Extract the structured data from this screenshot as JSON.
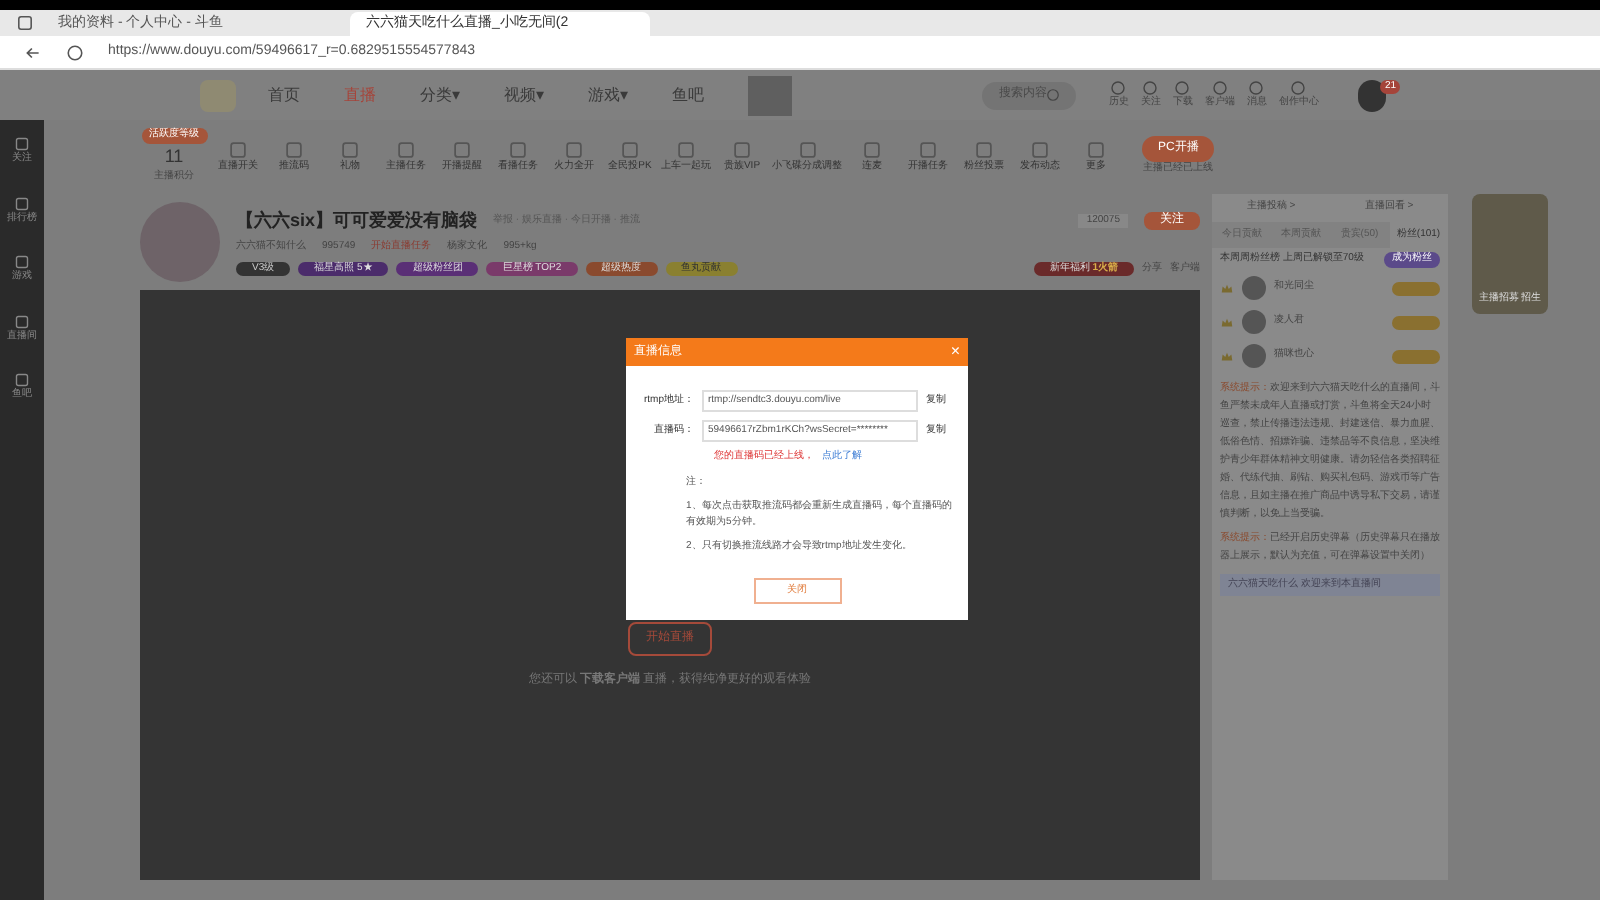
{
  "browser": {
    "tabs": [
      {
        "title": "我的资料 - 个人中心 - 斗鱼",
        "selected": false
      },
      {
        "title": "六六猫天吃什么直播_小吃无间(2",
        "selected": true
      }
    ],
    "url": "https://www.douyu.com/59496617_r=0.6829515554577843"
  },
  "nav": {
    "items": [
      {
        "label": "首页",
        "selected": false
      },
      {
        "label": "直播",
        "selected": true
      },
      {
        "label": "分类▾",
        "selected": false
      },
      {
        "label": "视频▾",
        "selected": false
      },
      {
        "label": "游戏▾",
        "selected": false
      },
      {
        "label": "鱼吧",
        "selected": false
      }
    ],
    "search": {
      "placeholder": "搜索内容"
    },
    "icons": [
      "历史",
      "关注",
      "下载",
      "客户端",
      "消息",
      "创作中心"
    ],
    "avatar_badge": "21"
  },
  "sidebar": [
    "关注",
    "排行榜",
    "游戏",
    "直播间",
    "鱼吧"
  ],
  "tools": {
    "score_tag": "活跃度等级",
    "score": "11",
    "score_label": "主播积分",
    "items": [
      "直播开关",
      "推流码",
      "礼物",
      "主播任务",
      "开播提醒",
      "看播任务",
      "火力全开",
      "全民投PK",
      "上车一起玩",
      "贵族VIP",
      "小飞碟分成调整",
      "连麦",
      "开播任务",
      "粉丝投票",
      "发布动态",
      "更多"
    ],
    "pc_button": "PC开播",
    "pc_note": "主播已经已上线"
  },
  "room": {
    "title": "【六六six】可可爱爱没有脑袋",
    "meta": "举报 · 娱乐直播 · 今日开播 · 推流",
    "name": "六六猫不知什么",
    "heat": "995749",
    "task": "开始直播任务",
    "org": "杨家文化",
    "weight": "995+kg",
    "badges": [
      "V3级",
      "福星高照 5★",
      "超级粉丝团",
      "巨星榜 TOP2",
      "超级热度",
      "鱼丸贡献"
    ],
    "follow_count": "120075",
    "follow": "关注",
    "gift": "新年福利",
    "gift_value": "1火箭",
    "share": "分享",
    "client": "客户端"
  },
  "video": {
    "start": "开始直播",
    "hint": "您还可以 **下载客户端** 直播，获得纯净更好的观看体验"
  },
  "modal": {
    "title": "直播信息",
    "close": "×",
    "rtmp_label": "rtmp地址：",
    "rtmp": "rtmp://sendtc3.douyu.com/live",
    "code_label": "直播码：",
    "code": "59496617rZbm1rKCh?wsSecret=********",
    "copy_rtmp": "复制",
    "copy_code": "复制",
    "warn": "您的直播码已经上线，",
    "link": "点此了解",
    "notes": [
      "注：",
      "1、每次点击获取推流码都会重新生成直播码，每个直播码的有效期为5分钟。",
      "2、只有切换推流线路才会导致rtmp地址发生变化。"
    ],
    "button": "关闭"
  },
  "panel": {
    "links": [
      "主播投稿 >",
      "直播回看 >"
    ],
    "tabs": [
      {
        "label": "今日贡献",
        "selected": false
      },
      {
        "label": "本周贡献",
        "selected": false
      },
      {
        "label": "贵宾(50)",
        "selected": false
      },
      {
        "label": "粉丝(101)",
        "selected": true
      }
    ],
    "fan_note": "本周周粉丝榜 上周已解锁至70级",
    "fan_button": "成为粉丝",
    "ranks": [
      "和光同尘",
      "凌人君",
      "猫咪也心"
    ],
    "messages": [
      {
        "label": "系统提示：",
        "text": "欢迎来到六六猫天吃什么的直播间，斗鱼严禁未成年人直播或打赏，斗鱼将全天24小时巡查，禁止传播违法违规、封建迷信、暴力血腥、低俗色情、招嫖诈骗、违禁品等不良信息，坚决维护青少年群体精神文明健康。请勿轻信各类招聘征婚、代练代抽、刷钻、购买礼包码、游戏币等广告信息，且如主播在推广商品中诱导私下交易，请谨慎判断，以免上当受骗。"
      },
      {
        "label": "系统提示：",
        "text": "已经开启历史弹幕（历史弹幕只在播放器上展示，默认为充值，可在弹幕设置中关闭）"
      }
    ],
    "welcome": "六六猫天吃什么 欢迎来到本直播间",
    "side_badge": "主播招募 招生"
  }
}
